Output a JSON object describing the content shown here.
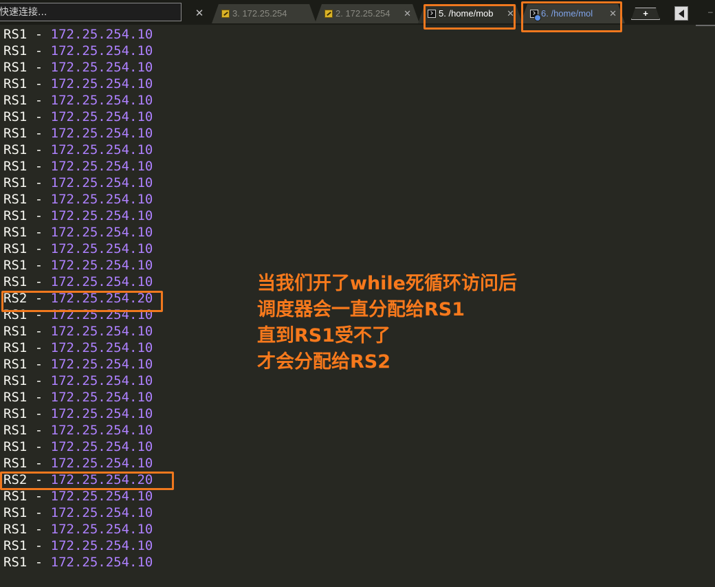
{
  "toolbar": {
    "quick_connect_placeholder": "快速连接...",
    "close_symbol": "✕",
    "new_tab_symbol": "+",
    "scroll_left_icon": "triangle-left-icon"
  },
  "tabs": [
    {
      "label": "3. 172.25.254",
      "icon": "key-icon",
      "close": "✕",
      "active": false
    },
    {
      "label": "2. 172.25.254",
      "icon": "key-icon",
      "close": "✕",
      "active": false
    },
    {
      "label": "5. /home/mob",
      "icon": "terminal-icon",
      "close": "✕",
      "active": true
    },
    {
      "label": "6. /home/mol",
      "icon": "terminal-icon",
      "close": "✕",
      "active": false
    }
  ],
  "terminal": {
    "separator": " - ",
    "lines": [
      {
        "host": "RS1",
        "ip": "172.25.254.10"
      },
      {
        "host": "RS1",
        "ip": "172.25.254.10"
      },
      {
        "host": "RS1",
        "ip": "172.25.254.10"
      },
      {
        "host": "RS1",
        "ip": "172.25.254.10"
      },
      {
        "host": "RS1",
        "ip": "172.25.254.10"
      },
      {
        "host": "RS1",
        "ip": "172.25.254.10"
      },
      {
        "host": "RS1",
        "ip": "172.25.254.10"
      },
      {
        "host": "RS1",
        "ip": "172.25.254.10"
      },
      {
        "host": "RS1",
        "ip": "172.25.254.10"
      },
      {
        "host": "RS1",
        "ip": "172.25.254.10"
      },
      {
        "host": "RS1",
        "ip": "172.25.254.10"
      },
      {
        "host": "RS1",
        "ip": "172.25.254.10"
      },
      {
        "host": "RS1",
        "ip": "172.25.254.10"
      },
      {
        "host": "RS1",
        "ip": "172.25.254.10"
      },
      {
        "host": "RS1",
        "ip": "172.25.254.10"
      },
      {
        "host": "RS1",
        "ip": "172.25.254.10"
      },
      {
        "host": "RS2",
        "ip": "172.25.254.20"
      },
      {
        "host": "RS1",
        "ip": "172.25.254.10"
      },
      {
        "host": "RS1",
        "ip": "172.25.254.10"
      },
      {
        "host": "RS1",
        "ip": "172.25.254.10"
      },
      {
        "host": "RS1",
        "ip": "172.25.254.10"
      },
      {
        "host": "RS1",
        "ip": "172.25.254.10"
      },
      {
        "host": "RS1",
        "ip": "172.25.254.10"
      },
      {
        "host": "RS1",
        "ip": "172.25.254.10"
      },
      {
        "host": "RS1",
        "ip": "172.25.254.10"
      },
      {
        "host": "RS1",
        "ip": "172.25.254.10"
      },
      {
        "host": "RS1",
        "ip": "172.25.254.10"
      },
      {
        "host": "RS2",
        "ip": "172.25.254.20"
      },
      {
        "host": "RS1",
        "ip": "172.25.254.10"
      },
      {
        "host": "RS1",
        "ip": "172.25.254.10"
      },
      {
        "host": "RS1",
        "ip": "172.25.254.10"
      },
      {
        "host": "RS1",
        "ip": "172.25.254.10"
      },
      {
        "host": "RS1",
        "ip": "172.25.254.10"
      }
    ]
  },
  "annotation": {
    "color": "#f7791c",
    "lines": [
      "当我们开了while死循环访问后",
      "调度器会一直分配给RS1",
      "直到RS1受不了",
      "才会分配给RS2"
    ]
  },
  "colors": {
    "background": "#272822",
    "text": "#f8f8f2",
    "ip": "#ae81ff",
    "highlight": "#f0781e"
  }
}
